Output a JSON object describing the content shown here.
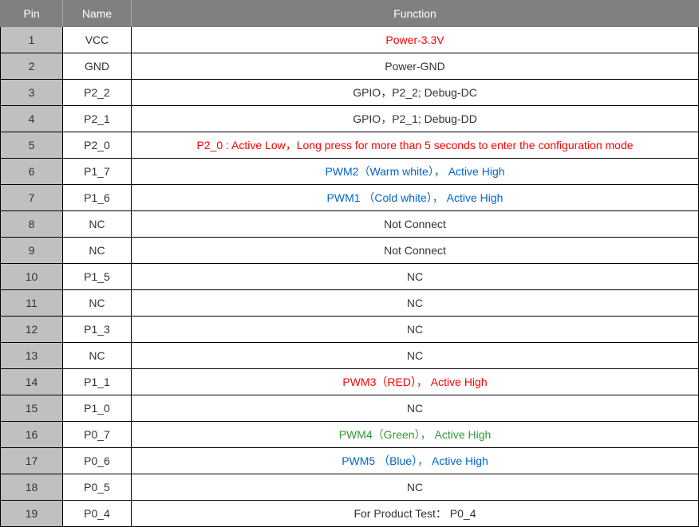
{
  "headers": {
    "pin": "Pin",
    "name": "Name",
    "function": "Function"
  },
  "rows": [
    {
      "pin": "1",
      "name": "VCC",
      "func": "Power-3.3V",
      "color": "red"
    },
    {
      "pin": "2",
      "name": "GND",
      "func": "Power-GND",
      "color": ""
    },
    {
      "pin": "3",
      "name": "P2_2",
      "func": "GPIO，P2_2; Debug-DC",
      "color": ""
    },
    {
      "pin": "4",
      "name": "P2_1",
      "func": "GPIO，P2_1; Debug-DD",
      "color": ""
    },
    {
      "pin": "5",
      "name": "P2_0",
      "func": "P2_0 : Active Low，Long press for more than 5 seconds to enter the configuration mode",
      "color": "red"
    },
    {
      "pin": "6",
      "name": "P1_7",
      "func": "PWM2（Warm white），  Active High",
      "color": "blue"
    },
    {
      "pin": "7",
      "name": "P1_6",
      "func": "PWM1 （Cold white），  Active High",
      "color": "blue"
    },
    {
      "pin": "8",
      "name": "NC",
      "func": "Not Connect",
      "color": ""
    },
    {
      "pin": "9",
      "name": "NC",
      "func": "Not Connect",
      "color": ""
    },
    {
      "pin": "10",
      "name": "P1_5",
      "func": "NC",
      "color": ""
    },
    {
      "pin": "11",
      "name": "NC",
      "func": "NC",
      "color": ""
    },
    {
      "pin": "12",
      "name": "P1_3",
      "func": "NC",
      "color": ""
    },
    {
      "pin": "13",
      "name": "NC",
      "func": "NC",
      "color": ""
    },
    {
      "pin": "14",
      "name": "P1_1",
      "func": "PWM3（RED），  Active High",
      "color": "red"
    },
    {
      "pin": "15",
      "name": "P1_0",
      "func": "NC",
      "color": ""
    },
    {
      "pin": "16",
      "name": "P0_7",
      "func": "PWM4（Green），  Active High",
      "color": "green"
    },
    {
      "pin": "17",
      "name": "P0_6",
      "func": "PWM5 （Blue），  Active High",
      "color": "blue"
    },
    {
      "pin": "18",
      "name": "P0_5",
      "func": "NC",
      "color": ""
    },
    {
      "pin": "19",
      "name": "P0_4",
      "func": "For Product Test： P0_4",
      "color": ""
    }
  ]
}
